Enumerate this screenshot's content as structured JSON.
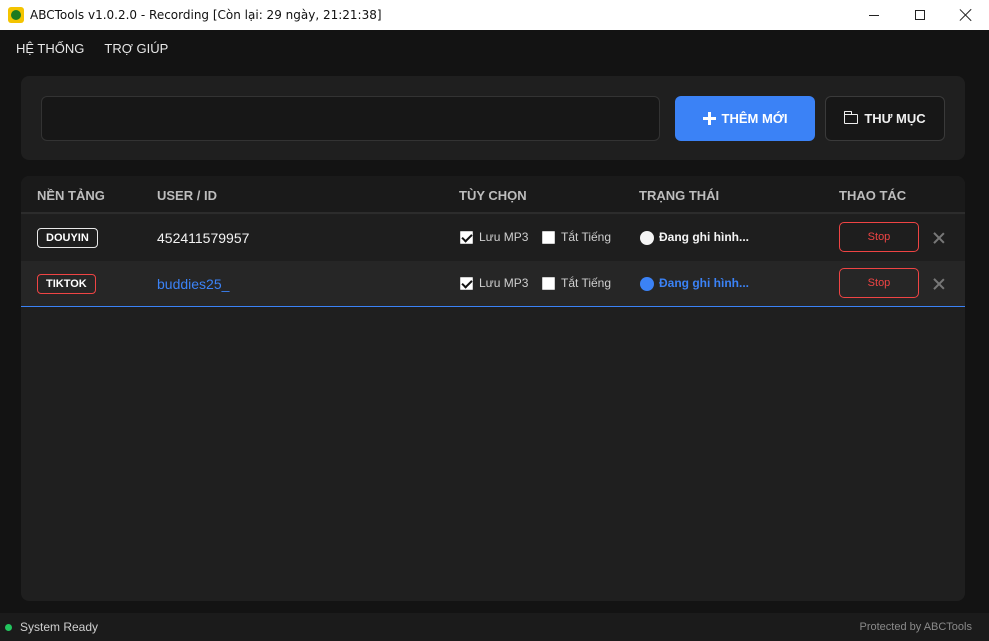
{
  "window": {
    "title": "ABCTools v1.0.2.0 - Recording [Còn lại: 29 ngày, 21:21:38]"
  },
  "menu": {
    "items": [
      "HỆ THỐNG",
      "TRỢ GIÚP"
    ]
  },
  "toolbar": {
    "input_value": "",
    "add_label": "THÊM MỚI",
    "folder_label": "THƯ MỤC",
    "accent_color": "#3b82f6"
  },
  "table": {
    "headers": [
      "NỀN TẢNG",
      "USER / ID",
      "TÙY CHỌN",
      "TRẠNG THÁI",
      "THAO TÁC"
    ],
    "rows": [
      {
        "platform": "DOUYIN",
        "user": "452411579957",
        "save_mp3_label": "Lưu MP3",
        "save_mp3": true,
        "mute_label": "Tắt Tiếng",
        "mute": false,
        "status": "Đang ghi hình...",
        "action": "Stop"
      },
      {
        "platform": "TIKTOK",
        "user": "buddies25_",
        "save_mp3_label": "Lưu MP3",
        "save_mp3": true,
        "mute_label": "Tắt Tiếng",
        "mute": false,
        "status": "Đang ghi hình...",
        "action": "Stop"
      }
    ]
  },
  "statusbar": {
    "status": "System Ready",
    "credit": "Protected by ABCTools",
    "status_color": "#22c55e"
  }
}
